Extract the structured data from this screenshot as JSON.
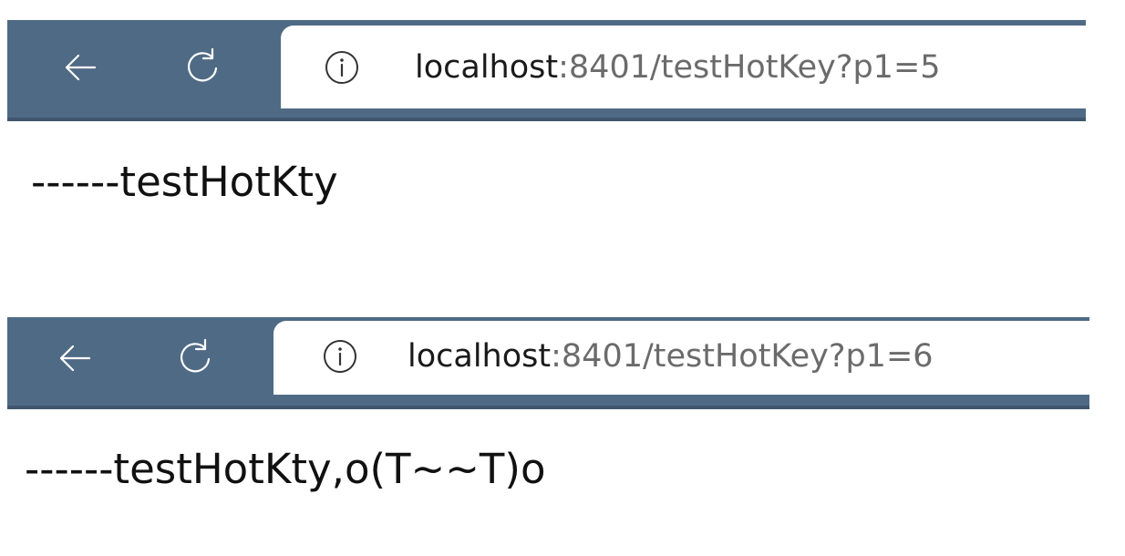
{
  "windows": [
    {
      "url": {
        "host": "localhost",
        "rest": ":8401/testHotKey?p1=5"
      },
      "content": "------testHotKty"
    },
    {
      "url": {
        "host": "localhost",
        "rest": ":8401/testHotKey?p1=6"
      },
      "content": "------testHotKty,o(T~~T)o"
    }
  ],
  "icons": {
    "back": "arrow-left-icon",
    "refresh": "refresh-icon",
    "info": "info-icon"
  },
  "colors": {
    "toolbar": "#4f6a85",
    "toolbar_border": "#3f566d",
    "url_host": "#1a1a1a",
    "url_rest": "#6b6b6b"
  }
}
